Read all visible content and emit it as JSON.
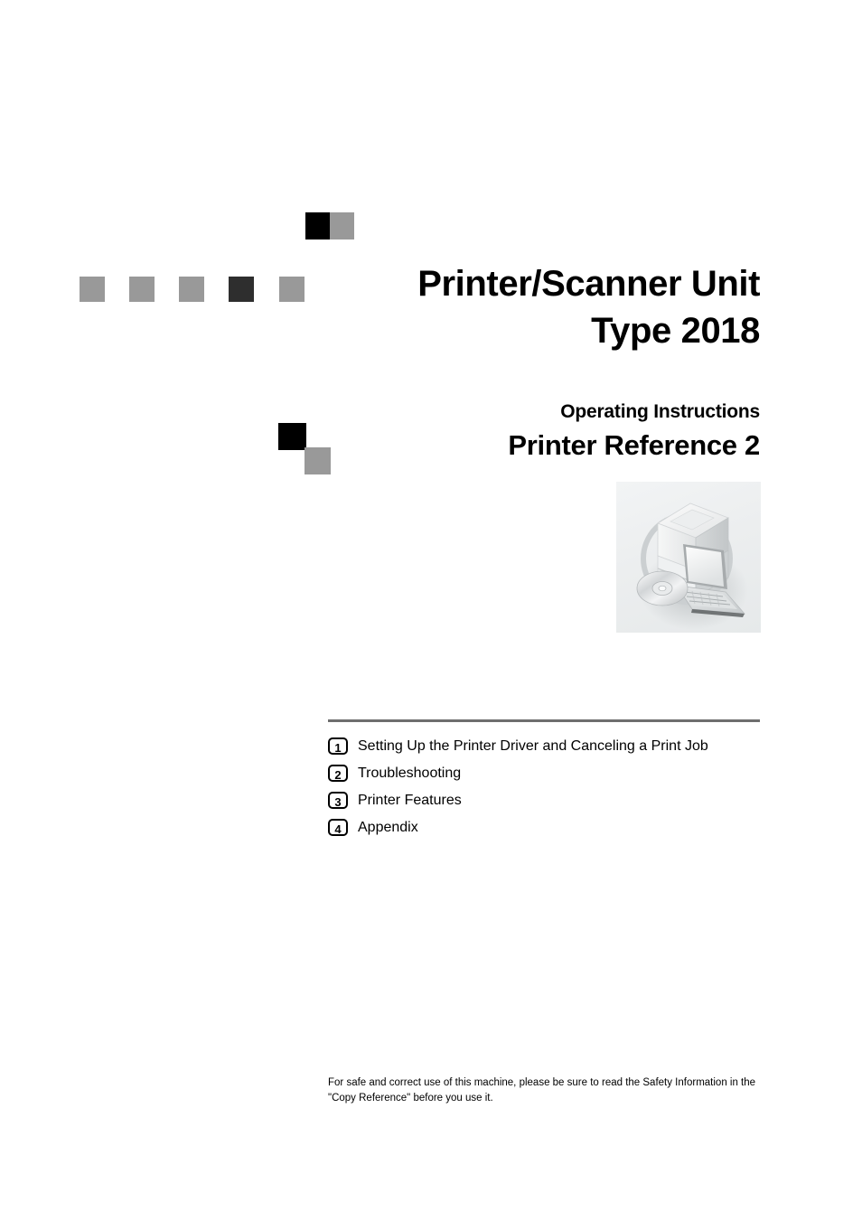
{
  "document": {
    "title_lines": [
      "Printer/Scanner Unit",
      "Type 2018"
    ],
    "operating_instructions_label": "Operating Instructions",
    "manual_name": "Printer Reference 2"
  },
  "illustration": {
    "alt": "multifunction-printer-laptop-cd-illustration"
  },
  "chapters": [
    {
      "number": "1",
      "label": "Setting Up the Printer Driver and Canceling a Print Job"
    },
    {
      "number": "2",
      "label": "Troubleshooting"
    },
    {
      "number": "3",
      "label": "Printer Features"
    },
    {
      "number": "4",
      "label": "Appendix"
    }
  ],
  "footer": {
    "line1": "For safe and correct use of this machine, please be sure to read the Safety Information in the",
    "line2": "\"Copy Reference\" before you use it."
  },
  "colors": {
    "black": "#000000",
    "dark_square": "#2e2e2e",
    "gray_square": "#999999",
    "rule": "#6e6e6e",
    "illustration_background": "#eceeef"
  }
}
